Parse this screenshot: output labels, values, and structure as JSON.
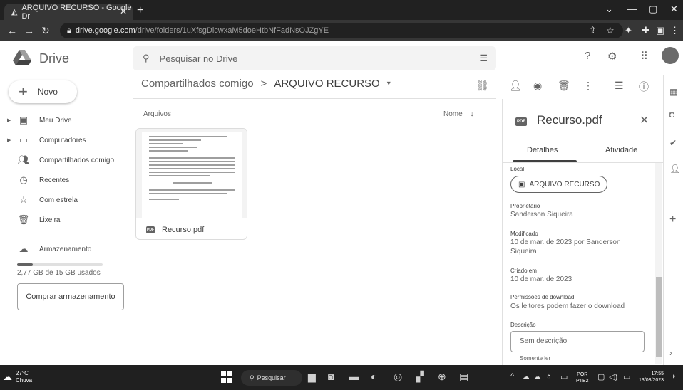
{
  "browser": {
    "tab_title": "ARQUIVO RECURSO - Google Dr",
    "url_host": "drive.google.com",
    "url_path": "/drive/folders/1uXfsgDicwxaM5doeHtbNfFadNsOJZgYE"
  },
  "app": {
    "brand": "Drive",
    "search_placeholder": "Pesquisar no Drive"
  },
  "sidebar": {
    "new_label": "Novo",
    "items": [
      {
        "label": "Meu Drive",
        "icon": "my-drive-icon"
      },
      {
        "label": "Computadores",
        "icon": "computer-icon"
      },
      {
        "label": "Compartilhados comigo",
        "icon": "people-icon"
      },
      {
        "label": "Recentes",
        "icon": "clock-icon"
      },
      {
        "label": "Com estrela",
        "icon": "star-icon"
      },
      {
        "label": "Lixeira",
        "icon": "trash-icon"
      }
    ],
    "storage_label": "Armazenamento",
    "storage_usage": "2,77 GB de 15 GB usados",
    "storage_fraction": 0.18,
    "buy_label": "Comprar armazenamento"
  },
  "main": {
    "breadcrumb_parent": "Compartilhados comigo",
    "breadcrumb_sep": ">",
    "breadcrumb_current": "ARQUIVO RECURSO",
    "files_header": "Arquivos",
    "sort_label": "Nome",
    "file_name": "Recurso.pdf",
    "pdf_badge": "PDF"
  },
  "details": {
    "title": "Recurso.pdf",
    "tab_details": "Detalhes",
    "tab_activity": "Atividade",
    "location_label": "Local",
    "location_value": "ARQUIVO RECURSO",
    "owner_label": "Proprietário",
    "owner_value": "Sanderson Siqueira",
    "modified_label": "Modificado",
    "modified_value": "10 de mar. de 2023 por Sanderson Siqueira",
    "created_label": "Criado em",
    "created_value": "10 de mar. de 2023",
    "perm_label": "Permissões de download",
    "perm_value": "Os leitores podem fazer o download",
    "desc_label": "Descrição",
    "desc_placeholder": "Sem descrição",
    "read_only": "Somente ler"
  },
  "taskbar": {
    "temp": "27°C",
    "weather": "Chuva",
    "search_label": "Pesquisar",
    "lang1": "POR",
    "lang2": "PTB2",
    "time": "17:55",
    "date": "13/03/2023"
  }
}
